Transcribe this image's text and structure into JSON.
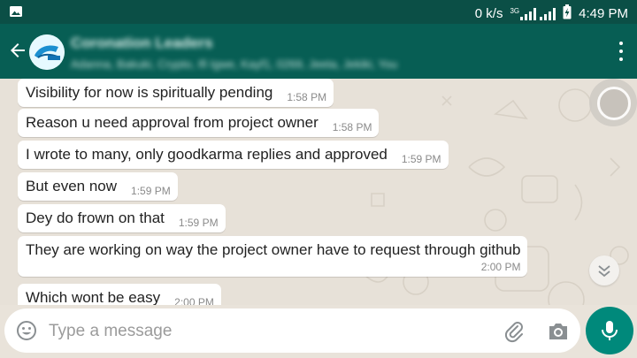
{
  "status_bar": {
    "net_speed": "0 k/s",
    "network_type": "3G",
    "time": "4:49 PM",
    "icons": [
      "image-notification-icon",
      "signal-icon",
      "battery-charging-icon"
    ]
  },
  "header": {
    "back_icon": "arrow-back-icon",
    "title": "Coronation Leaders",
    "subtitle": "Adanna, Bakuki, Crypto, Ifi Igwe, Kayf1, 0269, Jeeta, Jekiki, You",
    "menu_icon": "more-vert-icon"
  },
  "messages": [
    {
      "text": "Visibility for now is spiritually pending",
      "time": "1:58 PM"
    },
    {
      "text": "Reason u need approval from project owner",
      "time": "1:58 PM"
    },
    {
      "text": "I wrote to many, only goodkarma replies and approved",
      "time": "1:59 PM"
    },
    {
      "text": "But even now",
      "time": "1:59 PM"
    },
    {
      "text": "Dey do frown on that",
      "time": "1:59 PM"
    },
    {
      "text": "They are working on way the project owner have to request through github",
      "time": "2:00 PM"
    },
    {
      "text": "Which wont be easy",
      "time": "2:00 PM"
    }
  ],
  "composer": {
    "placeholder": "Type a message",
    "value": "",
    "icons": [
      "emoji-icon",
      "attach-icon",
      "camera-icon",
      "mic-icon"
    ]
  },
  "colors": {
    "status_bar": "#0b4f46",
    "header": "#075e54",
    "mic_button": "#00897b",
    "bubble": "#ffffff",
    "chat_background": "#e7e1d8"
  }
}
